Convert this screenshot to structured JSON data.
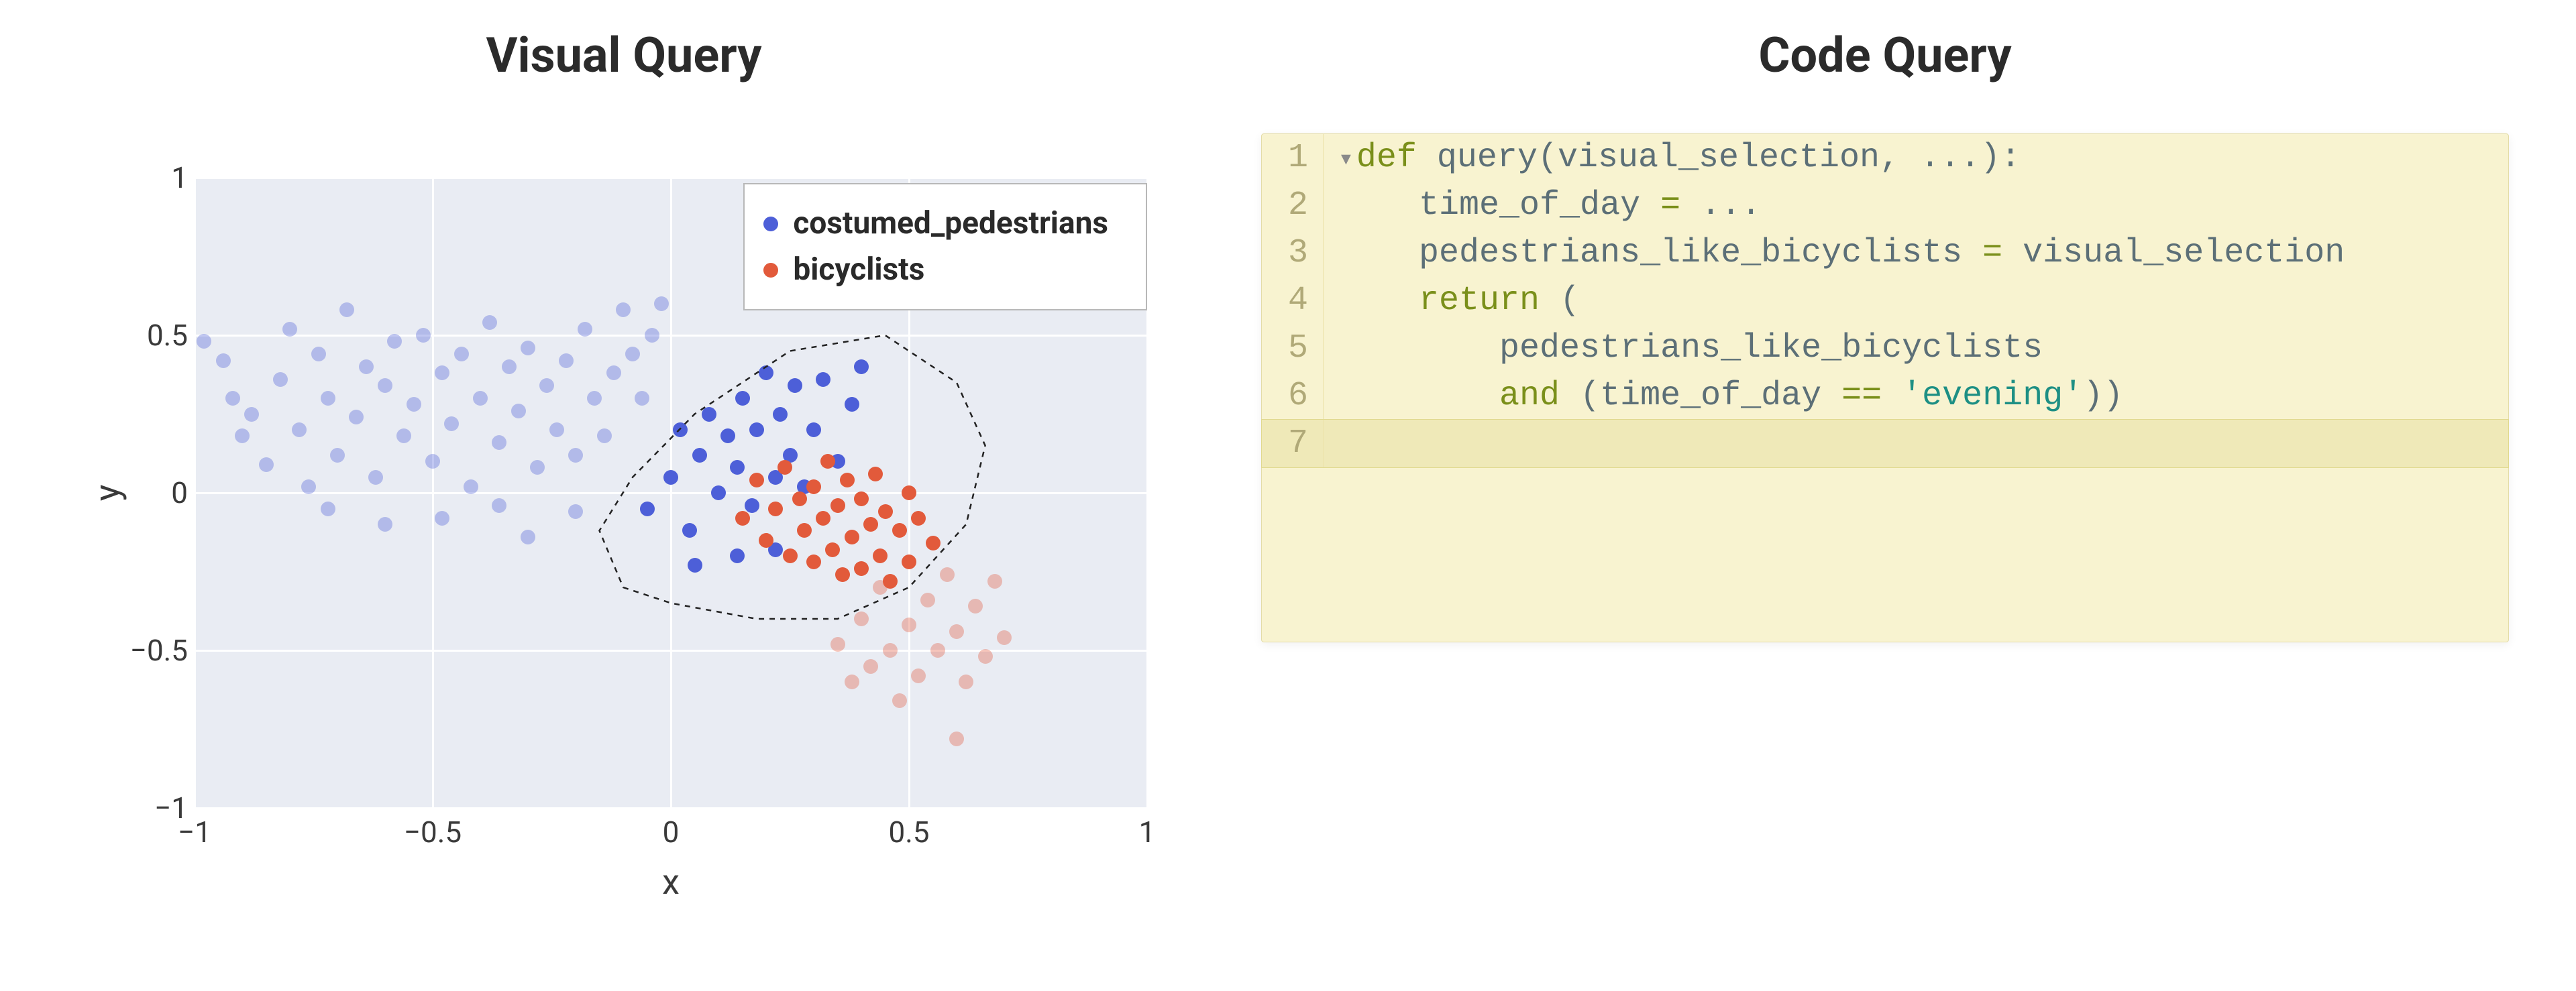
{
  "left": {
    "title": "Visual Query",
    "xlabel": "x",
    "ylabel": "y",
    "legend": {
      "items": [
        {
          "label": "costumed_pedestrians",
          "color": "#4d5fd8"
        },
        {
          "label": "bicyclists",
          "color": "#e25a3b"
        }
      ]
    },
    "xticks": [
      {
        "v": -1,
        "label": "−1"
      },
      {
        "v": -0.5,
        "label": "−0.5"
      },
      {
        "v": 0,
        "label": "0"
      },
      {
        "v": 0.5,
        "label": "0.5"
      },
      {
        "v": 1,
        "label": "1"
      }
    ],
    "yticks": [
      {
        "v": -1,
        "label": "−1"
      },
      {
        "v": -0.5,
        "label": "−0.5"
      },
      {
        "v": 0,
        "label": "0"
      },
      {
        "v": 0.5,
        "label": "0.5"
      },
      {
        "v": 1,
        "label": "1"
      }
    ],
    "lasso": [
      [
        -0.1,
        -0.3
      ],
      [
        0.0,
        -0.35
      ],
      [
        0.18,
        -0.4
      ],
      [
        0.35,
        -0.4
      ],
      [
        0.5,
        -0.3
      ],
      [
        0.62,
        -0.1
      ],
      [
        0.66,
        0.15
      ],
      [
        0.6,
        0.35
      ],
      [
        0.45,
        0.5
      ],
      [
        0.25,
        0.45
      ],
      [
        0.05,
        0.25
      ],
      [
        -0.08,
        0.05
      ],
      [
        -0.15,
        -0.12
      ],
      [
        -0.1,
        -0.3
      ]
    ]
  },
  "chart_data": {
    "type": "scatter",
    "title": "Visual Query",
    "xlabel": "x",
    "ylabel": "y",
    "xlim": [
      -1,
      1
    ],
    "ylim": [
      -1,
      1
    ],
    "grid": true,
    "legend_position": "upper right",
    "annotations": [
      {
        "kind": "lasso",
        "path": [
          [
            -0.1,
            -0.3
          ],
          [
            0.0,
            -0.35
          ],
          [
            0.18,
            -0.4
          ],
          [
            0.35,
            -0.4
          ],
          [
            0.5,
            -0.3
          ],
          [
            0.62,
            -0.1
          ],
          [
            0.66,
            0.15
          ],
          [
            0.6,
            0.35
          ],
          [
            0.45,
            0.5
          ],
          [
            0.25,
            0.45
          ],
          [
            0.05,
            0.25
          ],
          [
            -0.08,
            0.05
          ],
          [
            -0.15,
            -0.12
          ],
          [
            -0.1,
            -0.3
          ]
        ]
      }
    ],
    "series": [
      {
        "name": "costumed_pedestrians",
        "color": "#4d5fd8",
        "points": [
          {
            "x": -0.98,
            "y": 0.48,
            "sel": false
          },
          {
            "x": -0.94,
            "y": 0.42,
            "sel": false
          },
          {
            "x": -0.92,
            "y": 0.3,
            "sel": false
          },
          {
            "x": -0.9,
            "y": 0.18,
            "sel": false
          },
          {
            "x": -0.88,
            "y": 0.25,
            "sel": false
          },
          {
            "x": -0.85,
            "y": 0.09,
            "sel": false
          },
          {
            "x": -0.82,
            "y": 0.36,
            "sel": false
          },
          {
            "x": -0.8,
            "y": 0.52,
            "sel": false
          },
          {
            "x": -0.78,
            "y": 0.2,
            "sel": false
          },
          {
            "x": -0.76,
            "y": 0.02,
            "sel": false
          },
          {
            "x": -0.74,
            "y": 0.44,
            "sel": false
          },
          {
            "x": -0.72,
            "y": 0.3,
            "sel": false
          },
          {
            "x": -0.7,
            "y": 0.12,
            "sel": false
          },
          {
            "x": -0.68,
            "y": 0.58,
            "sel": false
          },
          {
            "x": -0.66,
            "y": 0.24,
            "sel": false
          },
          {
            "x": -0.64,
            "y": 0.4,
            "sel": false
          },
          {
            "x": -0.62,
            "y": 0.05,
            "sel": false
          },
          {
            "x": -0.6,
            "y": 0.34,
            "sel": false
          },
          {
            "x": -0.58,
            "y": 0.48,
            "sel": false
          },
          {
            "x": -0.56,
            "y": 0.18,
            "sel": false
          },
          {
            "x": -0.54,
            "y": 0.28,
            "sel": false
          },
          {
            "x": -0.52,
            "y": 0.5,
            "sel": false
          },
          {
            "x": -0.5,
            "y": 0.1,
            "sel": false
          },
          {
            "x": -0.48,
            "y": 0.38,
            "sel": false
          },
          {
            "x": -0.46,
            "y": 0.22,
            "sel": false
          },
          {
            "x": -0.44,
            "y": 0.44,
            "sel": false
          },
          {
            "x": -0.42,
            "y": 0.02,
            "sel": false
          },
          {
            "x": -0.4,
            "y": 0.3,
            "sel": false
          },
          {
            "x": -0.38,
            "y": 0.54,
            "sel": false
          },
          {
            "x": -0.36,
            "y": 0.16,
            "sel": false
          },
          {
            "x": -0.34,
            "y": 0.4,
            "sel": false
          },
          {
            "x": -0.32,
            "y": 0.26,
            "sel": false
          },
          {
            "x": -0.3,
            "y": 0.46,
            "sel": false
          },
          {
            "x": -0.28,
            "y": 0.08,
            "sel": false
          },
          {
            "x": -0.26,
            "y": 0.34,
            "sel": false
          },
          {
            "x": -0.24,
            "y": 0.2,
            "sel": false
          },
          {
            "x": -0.22,
            "y": 0.42,
            "sel": false
          },
          {
            "x": -0.2,
            "y": 0.12,
            "sel": false
          },
          {
            "x": -0.18,
            "y": 0.52,
            "sel": false
          },
          {
            "x": -0.16,
            "y": 0.3,
            "sel": false
          },
          {
            "x": -0.14,
            "y": 0.18,
            "sel": false
          },
          {
            "x": -0.12,
            "y": 0.38,
            "sel": false
          },
          {
            "x": -0.1,
            "y": 0.58,
            "sel": false
          },
          {
            "x": -0.08,
            "y": 0.44,
            "sel": false
          },
          {
            "x": -0.06,
            "y": 0.3,
            "sel": false
          },
          {
            "x": -0.04,
            "y": 0.5,
            "sel": false
          },
          {
            "x": -0.02,
            "y": 0.6,
            "sel": false
          },
          {
            "x": -0.72,
            "y": -0.05,
            "sel": false
          },
          {
            "x": -0.6,
            "y": -0.1,
            "sel": false
          },
          {
            "x": -0.48,
            "y": -0.08,
            "sel": false
          },
          {
            "x": -0.36,
            "y": -0.04,
            "sel": false
          },
          {
            "x": -0.3,
            "y": -0.14,
            "sel": false
          },
          {
            "x": -0.2,
            "y": -0.06,
            "sel": false
          },
          {
            "x": -0.05,
            "y": -0.05,
            "sel": true
          },
          {
            "x": 0.0,
            "y": 0.05,
            "sel": true
          },
          {
            "x": 0.02,
            "y": 0.2,
            "sel": true
          },
          {
            "x": 0.04,
            "y": -0.12,
            "sel": true
          },
          {
            "x": 0.06,
            "y": 0.12,
            "sel": true
          },
          {
            "x": 0.08,
            "y": 0.25,
            "sel": true
          },
          {
            "x": 0.1,
            "y": 0.0,
            "sel": true
          },
          {
            "x": 0.12,
            "y": 0.18,
            "sel": true
          },
          {
            "x": 0.14,
            "y": 0.08,
            "sel": true
          },
          {
            "x": 0.15,
            "y": 0.3,
            "sel": true
          },
          {
            "x": 0.17,
            "y": -0.04,
            "sel": true
          },
          {
            "x": 0.18,
            "y": 0.2,
            "sel": true
          },
          {
            "x": 0.2,
            "y": 0.38,
            "sel": true
          },
          {
            "x": 0.22,
            "y": 0.05,
            "sel": true
          },
          {
            "x": 0.23,
            "y": 0.25,
            "sel": true
          },
          {
            "x": 0.25,
            "y": 0.12,
            "sel": true
          },
          {
            "x": 0.26,
            "y": 0.34,
            "sel": true
          },
          {
            "x": 0.28,
            "y": 0.02,
            "sel": true
          },
          {
            "x": 0.3,
            "y": 0.2,
            "sel": true
          },
          {
            "x": 0.32,
            "y": 0.36,
            "sel": true
          },
          {
            "x": 0.35,
            "y": 0.1,
            "sel": true
          },
          {
            "x": 0.38,
            "y": 0.28,
            "sel": true
          },
          {
            "x": 0.4,
            "y": 0.4,
            "sel": true
          },
          {
            "x": 0.14,
            "y": -0.2,
            "sel": true
          },
          {
            "x": 0.05,
            "y": -0.23,
            "sel": true
          },
          {
            "x": 0.22,
            "y": -0.18,
            "sel": true
          }
        ]
      },
      {
        "name": "bicyclists",
        "color": "#e25a3b",
        "points": [
          {
            "x": 0.35,
            "y": -0.48,
            "sel": false
          },
          {
            "x": 0.38,
            "y": -0.6,
            "sel": false
          },
          {
            "x": 0.4,
            "y": -0.4,
            "sel": false
          },
          {
            "x": 0.42,
            "y": -0.55,
            "sel": false
          },
          {
            "x": 0.44,
            "y": -0.3,
            "sel": false
          },
          {
            "x": 0.46,
            "y": -0.5,
            "sel": false
          },
          {
            "x": 0.48,
            "y": -0.66,
            "sel": false
          },
          {
            "x": 0.5,
            "y": -0.42,
            "sel": false
          },
          {
            "x": 0.52,
            "y": -0.58,
            "sel": false
          },
          {
            "x": 0.54,
            "y": -0.34,
            "sel": false
          },
          {
            "x": 0.56,
            "y": -0.5,
            "sel": false
          },
          {
            "x": 0.58,
            "y": -0.26,
            "sel": false
          },
          {
            "x": 0.6,
            "y": -0.44,
            "sel": false
          },
          {
            "x": 0.62,
            "y": -0.6,
            "sel": false
          },
          {
            "x": 0.64,
            "y": -0.36,
            "sel": false
          },
          {
            "x": 0.66,
            "y": -0.52,
            "sel": false
          },
          {
            "x": 0.68,
            "y": -0.28,
            "sel": false
          },
          {
            "x": 0.7,
            "y": -0.46,
            "sel": false
          },
          {
            "x": 0.6,
            "y": -0.78,
            "sel": false
          },
          {
            "x": 0.15,
            "y": -0.08,
            "sel": true
          },
          {
            "x": 0.18,
            "y": 0.04,
            "sel": true
          },
          {
            "x": 0.2,
            "y": -0.15,
            "sel": true
          },
          {
            "x": 0.22,
            "y": -0.05,
            "sel": true
          },
          {
            "x": 0.24,
            "y": 0.08,
            "sel": true
          },
          {
            "x": 0.25,
            "y": -0.2,
            "sel": true
          },
          {
            "x": 0.27,
            "y": -0.02,
            "sel": true
          },
          {
            "x": 0.28,
            "y": -0.12,
            "sel": true
          },
          {
            "x": 0.3,
            "y": 0.02,
            "sel": true
          },
          {
            "x": 0.3,
            "y": -0.22,
            "sel": true
          },
          {
            "x": 0.32,
            "y": -0.08,
            "sel": true
          },
          {
            "x": 0.33,
            "y": 0.1,
            "sel": true
          },
          {
            "x": 0.34,
            "y": -0.18,
            "sel": true
          },
          {
            "x": 0.35,
            "y": -0.04,
            "sel": true
          },
          {
            "x": 0.36,
            "y": -0.26,
            "sel": true
          },
          {
            "x": 0.37,
            "y": 0.04,
            "sel": true
          },
          {
            "x": 0.38,
            "y": -0.14,
            "sel": true
          },
          {
            "x": 0.4,
            "y": -0.02,
            "sel": true
          },
          {
            "x": 0.4,
            "y": -0.24,
            "sel": true
          },
          {
            "x": 0.42,
            "y": -0.1,
            "sel": true
          },
          {
            "x": 0.43,
            "y": 0.06,
            "sel": true
          },
          {
            "x": 0.44,
            "y": -0.2,
            "sel": true
          },
          {
            "x": 0.45,
            "y": -0.06,
            "sel": true
          },
          {
            "x": 0.46,
            "y": -0.28,
            "sel": true
          },
          {
            "x": 0.48,
            "y": -0.12,
            "sel": true
          },
          {
            "x": 0.5,
            "y": 0.0,
            "sel": true
          },
          {
            "x": 0.5,
            "y": -0.22,
            "sel": true
          },
          {
            "x": 0.52,
            "y": -0.08,
            "sel": true
          },
          {
            "x": 0.55,
            "y": -0.16,
            "sel": true
          }
        ]
      }
    ]
  },
  "right": {
    "title": "Code Query",
    "lines": [
      {
        "n": "1",
        "fold": true,
        "tokens": [
          {
            "t": "def ",
            "c": "kw"
          },
          {
            "t": "query",
            "c": "fn"
          },
          {
            "t": "(visual_selection, ...):",
            "c": "fn"
          }
        ]
      },
      {
        "n": "2",
        "tokens": [
          {
            "t": "    time_of_day ",
            "c": "fn"
          },
          {
            "t": "=",
            "c": "op"
          },
          {
            "t": " ...",
            "c": "fn"
          }
        ]
      },
      {
        "n": "3",
        "tokens": [
          {
            "t": "    pedestrians_like_bicyclists ",
            "c": "fn"
          },
          {
            "t": "=",
            "c": "op"
          },
          {
            "t": " visual_selection",
            "c": "fn"
          }
        ]
      },
      {
        "n": "4",
        "tokens": [
          {
            "t": "    ",
            "c": "fn"
          },
          {
            "t": "return",
            "c": "kw"
          },
          {
            "t": " (",
            "c": "fn"
          }
        ]
      },
      {
        "n": "5",
        "tokens": [
          {
            "t": "        pedestrians_like_bicyclists",
            "c": "fn"
          }
        ]
      },
      {
        "n": "6",
        "tokens": [
          {
            "t": "        ",
            "c": "fn"
          },
          {
            "t": "and",
            "c": "kw"
          },
          {
            "t": " (time_of_day ",
            "c": "fn"
          },
          {
            "t": "==",
            "c": "op"
          },
          {
            "t": " ",
            "c": "fn"
          },
          {
            "t": "'evening'",
            "c": "str"
          },
          {
            "t": "))",
            "c": "fn"
          }
        ]
      },
      {
        "n": "7",
        "active": true,
        "tokens": [
          {
            "t": "    ",
            "c": "fn"
          }
        ]
      }
    ]
  }
}
